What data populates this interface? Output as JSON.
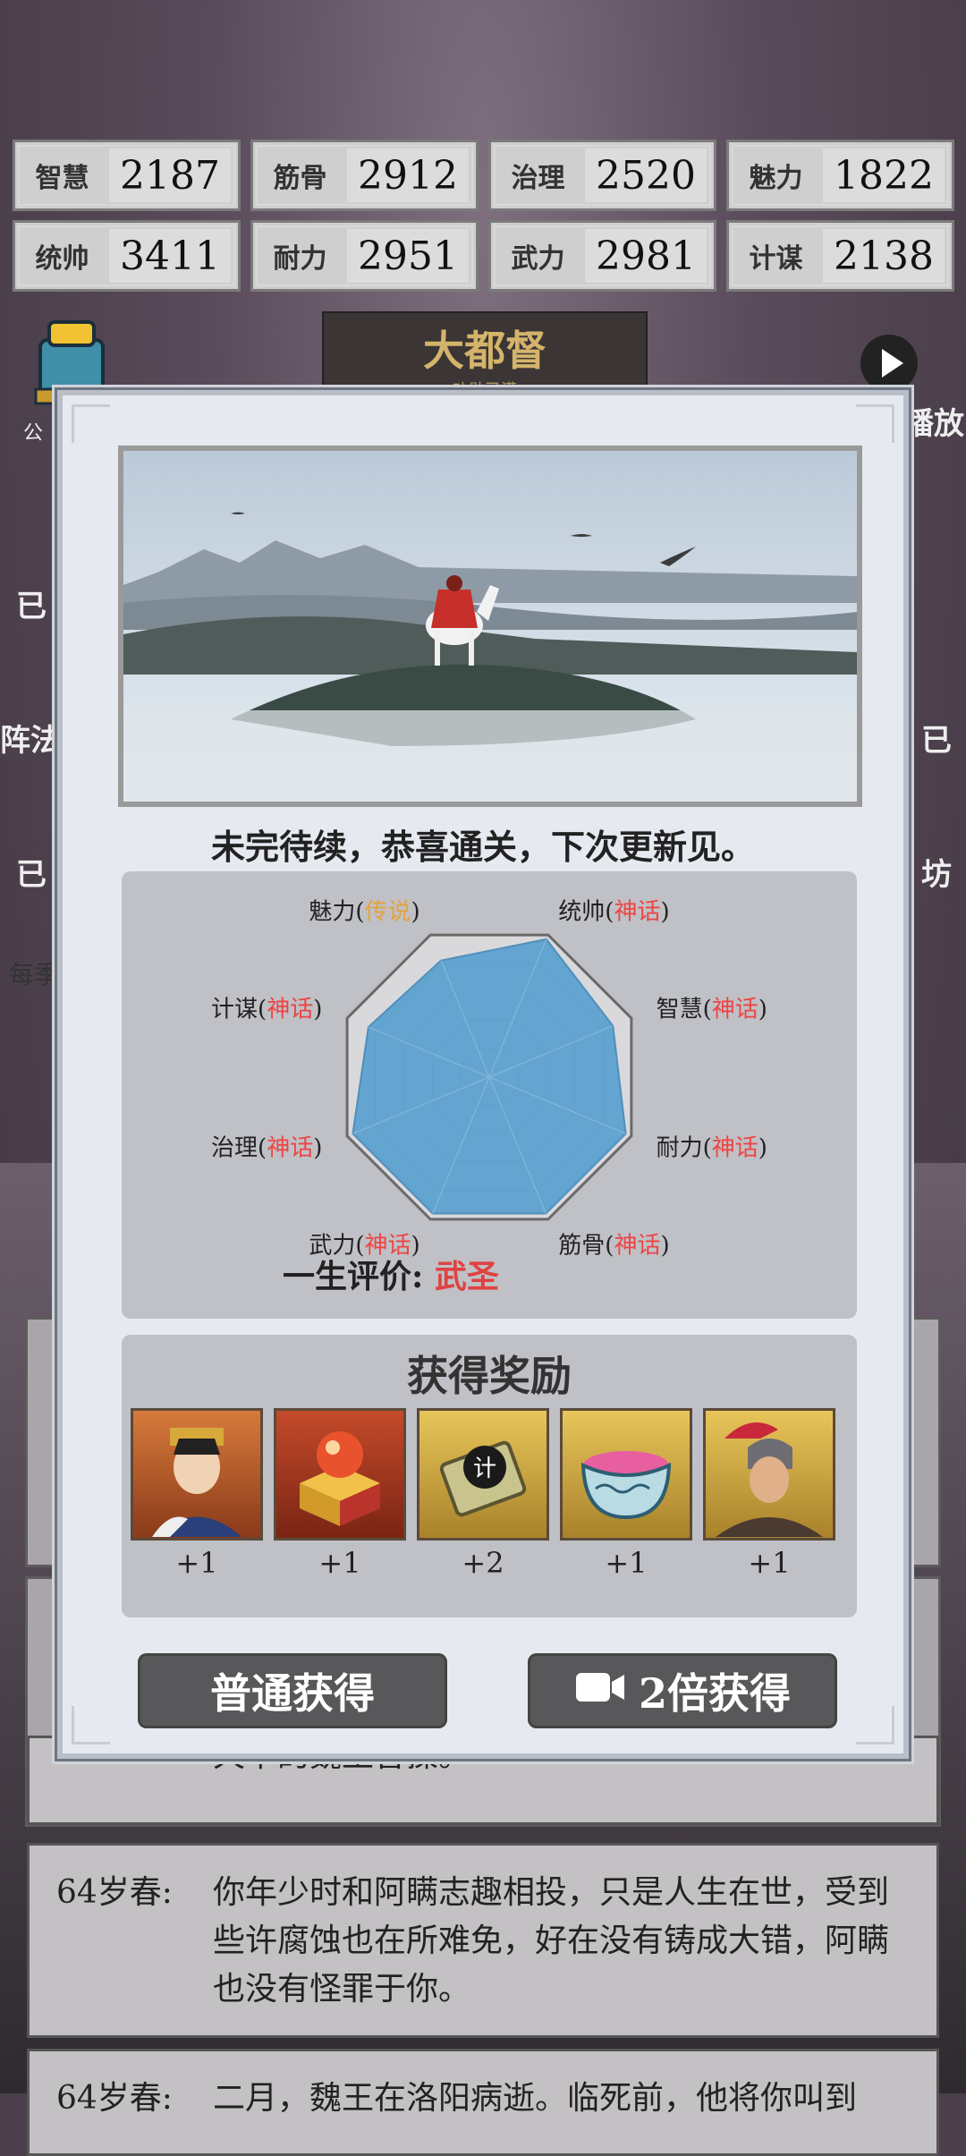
{
  "stats": [
    {
      "label": "智慧",
      "value": "2187"
    },
    {
      "label": "筋骨",
      "value": "2912"
    },
    {
      "label": "治理",
      "value": "2520"
    },
    {
      "label": "魅力",
      "value": "1822"
    },
    {
      "label": "统帅",
      "value": "3411"
    },
    {
      "label": "耐力",
      "value": "2951"
    },
    {
      "label": "武力",
      "value": "2981"
    },
    {
      "label": "计谋",
      "value": "2138"
    }
  ],
  "background": {
    "rank_title": "大都督",
    "rank_sub": "功勋已满",
    "story1_age": "64岁春:",
    "story1_text": "你年少时和阿瞒志趣相投，只是人生在世，受到些许腐蚀也在所难免，好在没有铸成大错，阿瞒也没有怪罪于你。",
    "story2_age": "64岁春:",
    "story2_text": "二月，魏王在洛阳病逝。临死前，他将你叫到",
    "partial_text": "天下的魏王曹操。",
    "left_labels": [
      "公",
      "已",
      "阵法",
      "已",
      "每季"
    ],
    "right_labels": [
      "播放",
      "已",
      "坊"
    ]
  },
  "modal": {
    "caption": "未完待续，恭喜通关，下次更新见。",
    "verdict_label": "一生评价:",
    "verdict_value": "武圣",
    "radar": [
      {
        "attr": "魅力",
        "grade": "传说",
        "grade_color": "#e6a23c",
        "level": 0.82
      },
      {
        "attr": "统帅",
        "grade": "神话",
        "grade_color": "#ee4444",
        "level": 0.97
      },
      {
        "attr": "智慧",
        "grade": "神话",
        "grade_color": "#ee4444",
        "level": 0.87
      },
      {
        "attr": "耐力",
        "grade": "神话",
        "grade_color": "#ee4444",
        "level": 0.96
      },
      {
        "attr": "筋骨",
        "grade": "神话",
        "grade_color": "#ee4444",
        "level": 0.96
      },
      {
        "attr": "武力",
        "grade": "神话",
        "grade_color": "#ee4444",
        "level": 0.96
      },
      {
        "attr": "治理",
        "grade": "神话",
        "grade_color": "#ee4444",
        "level": 0.96
      },
      {
        "attr": "计谋",
        "grade": "神话",
        "grade_color": "#ee4444",
        "level": 0.85
      }
    ],
    "reward_title": "获得奖励",
    "rewards": [
      {
        "icon": "general-portrait-icon",
        "count": "+1"
      },
      {
        "icon": "red-orb-chest-icon",
        "count": "+1"
      },
      {
        "icon": "strategy-scroll-icon",
        "count": "+2"
      },
      {
        "icon": "porcelain-bowl-icon",
        "count": "+1"
      },
      {
        "icon": "warrior-portrait-icon",
        "count": "+1"
      }
    ],
    "btn_normal": "普通获得",
    "btn_double": "2倍获得"
  }
}
